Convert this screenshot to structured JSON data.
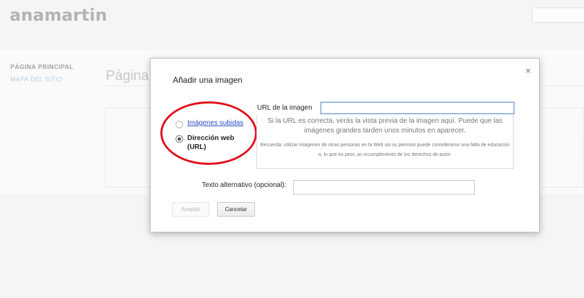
{
  "site": {
    "title": "anamartin"
  },
  "nav": {
    "items": [
      {
        "label": "PÁGINA PRINCIPAL"
      },
      {
        "label": "MAPA DEL SITIO"
      }
    ]
  },
  "page": {
    "heading": "Página"
  },
  "dialog": {
    "title": "Añadir una imagen",
    "close": "×",
    "radio_uploaded": "Imágenes subidas",
    "radio_web_line1": "Dirección web",
    "radio_web_line2": "(URL)",
    "url_label": "URL de la imagen",
    "url_value": "",
    "preview_message": "Si la URL es correcta, verás la vista previa de la imagen aquí. Puede que las imágenes grandes tarden unos minutos en aparecer.",
    "preview_note": "Recuerda: utilizar imágenes de otras personas en la Web sin su permiso puede considerarse una falta de educación o, lo que es peor, un incumplimiento de los derechos de autor.",
    "alt_label": "Texto alternativo (opcional):",
    "alt_value": "",
    "accept_label": "Aceptar",
    "cancel_label": "Cancelar"
  },
  "colors": {
    "highlight": "#e0101c",
    "link": "#2a4bbf"
  }
}
